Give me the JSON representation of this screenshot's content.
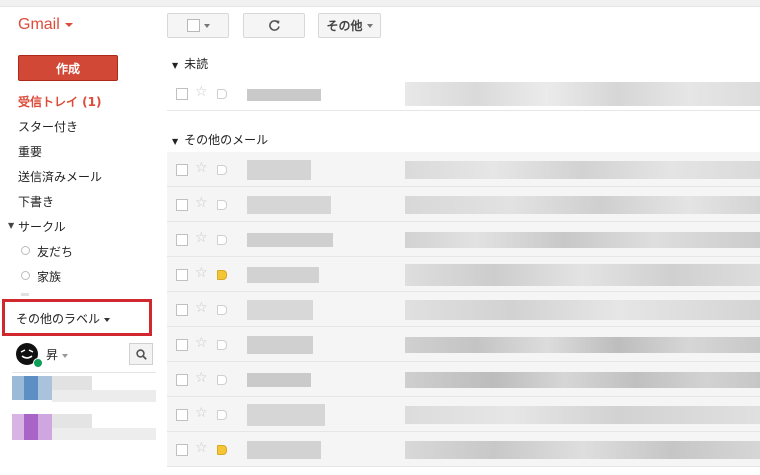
{
  "brand": {
    "label": "Gmail"
  },
  "toolbar": {
    "more_label": "その他"
  },
  "compose_label": "作成",
  "nav": {
    "inbox": "受信トレイ (1)",
    "starred": "スター付き",
    "important": "重要",
    "sent": "送信済みメール",
    "drafts": "下書き",
    "circles": "サークル",
    "circle_friends": "友だち",
    "circle_family": "家族",
    "more_labels": "その他のラベル"
  },
  "chat": {
    "user_initial": "昇"
  },
  "sections": {
    "unread": "未読",
    "other": "その他のメール"
  },
  "icons": {
    "star": "star-icon",
    "refresh": "refresh-icon",
    "search": "search-icon",
    "label": "label-tag-icon"
  },
  "colors": {
    "brand_red": "#dd4b39",
    "compose_red": "#d14836",
    "highlight_red": "#d0282e",
    "important_yellow": "#f4c534",
    "online_green": "#0f9d58"
  }
}
